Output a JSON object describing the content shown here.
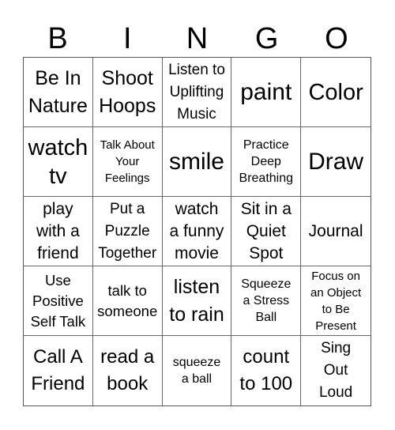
{
  "header": {
    "letters": [
      "B",
      "I",
      "N",
      "G",
      "O"
    ]
  },
  "cells": [
    "Be In\nNature",
    "Shoot\nHoops",
    "Listen to\nUplifting\nMusic",
    "paint",
    "Color",
    "watch\ntv",
    "Talk About\nYour\nFeelings",
    "smile",
    "Practice\nDeep\nBreathing",
    "Draw",
    "play\nwith a\nfriend",
    "Put a\nPuzzle\nTogether",
    "watch\na funny\nmovie",
    "Sit in a\nQuiet\nSpot",
    "Journal",
    "Use\nPositive\nSelf Talk",
    "talk to\nsomeone",
    "listen\nto rain",
    "Squeeze\na Stress\nBall",
    "Focus on\nan Object\nto Be\nPresent",
    "Call A\nFriend",
    "read a\nbook",
    "squeeze\na ball",
    "count\nto 100",
    "Sing\nOut\nLoud"
  ]
}
